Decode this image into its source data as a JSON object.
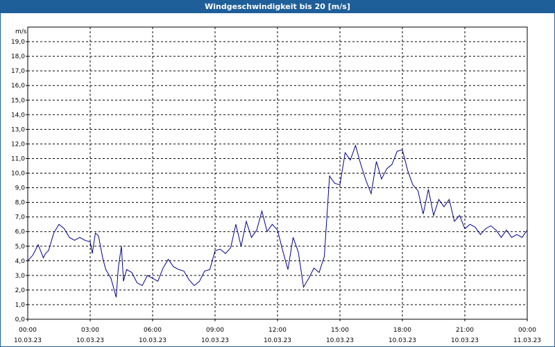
{
  "window": {
    "title": "Windgeschwindigkeit bis 20 [m/s]"
  },
  "chart_data": {
    "type": "line",
    "title": "Windgeschwindigkeit bis 20 [m/s]",
    "ylabel": "m/s",
    "xlabel": "",
    "ylim": [
      0,
      20
    ],
    "xlim_hours": [
      0,
      24
    ],
    "grid": true,
    "y_ticks": [
      "0,0",
      "1,0",
      "2,0",
      "3,0",
      "4,0",
      "5,0",
      "6,0",
      "7,0",
      "8,0",
      "9,0",
      "10,0",
      "11,0",
      "12,0",
      "13,0",
      "14,0",
      "15,0",
      "16,0",
      "17,0",
      "18,0",
      "19,0"
    ],
    "x_ticks": [
      {
        "time": "00:00",
        "date": "10.03.23",
        "hour": 0
      },
      {
        "time": "03:00",
        "date": "10.03.23",
        "hour": 3
      },
      {
        "time": "06:00",
        "date": "10.03.23",
        "hour": 6
      },
      {
        "time": "09:00",
        "date": "10.03.23",
        "hour": 9
      },
      {
        "time": "12:00",
        "date": "10.03.23",
        "hour": 12
      },
      {
        "time": "15:00",
        "date": "10.03.23",
        "hour": 15
      },
      {
        "time": "18:00",
        "date": "10.03.23",
        "hour": 18
      },
      {
        "time": "21:00",
        "date": "10.03.23",
        "hour": 21
      },
      {
        "time": "00:00",
        "date": "11.03.23",
        "hour": 24
      }
    ],
    "series": [
      {
        "color": "#00008b",
        "x": [
          0.0,
          0.25,
          0.5,
          0.75,
          0.85,
          1.0,
          1.25,
          1.5,
          1.75,
          2.0,
          2.25,
          2.5,
          2.75,
          3.0,
          3.1,
          3.25,
          3.4,
          3.6,
          3.75,
          4.0,
          4.25,
          4.35,
          4.5,
          4.6,
          4.75,
          5.0,
          5.25,
          5.5,
          5.75,
          6.0,
          6.25,
          6.5,
          6.75,
          7.0,
          7.25,
          7.5,
          7.75,
          8.0,
          8.25,
          8.5,
          8.75,
          9.0,
          9.25,
          9.5,
          9.75,
          10.0,
          10.25,
          10.5,
          10.75,
          11.0,
          11.25,
          11.5,
          11.75,
          12.0,
          12.25,
          12.5,
          12.75,
          13.0,
          13.25,
          13.5,
          13.75,
          14.0,
          14.25,
          14.5,
          14.75,
          15.0,
          15.25,
          15.5,
          15.75,
          16.0,
          16.25,
          16.5,
          16.75,
          17.0,
          17.25,
          17.5,
          17.75,
          18.0,
          18.25,
          18.5,
          18.75,
          19.0,
          19.25,
          19.5,
          19.75,
          20.0,
          20.25,
          20.5,
          20.75,
          21.0,
          21.25,
          21.5,
          21.75,
          22.0,
          22.25,
          22.5,
          22.75,
          23.0,
          23.25,
          23.5,
          23.75,
          24.0
        ],
        "y": [
          4.0,
          4.4,
          5.1,
          4.2,
          4.5,
          4.7,
          5.9,
          6.5,
          6.2,
          5.6,
          5.4,
          5.6,
          5.4,
          5.3,
          4.5,
          5.9,
          5.7,
          4.2,
          3.4,
          2.8,
          1.5,
          3.5,
          5.0,
          2.6,
          3.4,
          3.2,
          2.5,
          2.3,
          3.0,
          2.8,
          2.6,
          3.5,
          4.1,
          3.6,
          3.4,
          3.3,
          2.7,
          2.3,
          2.6,
          3.3,
          3.4,
          4.7,
          4.8,
          4.5,
          4.9,
          6.5,
          5.0,
          6.7,
          5.6,
          6.1,
          7.4,
          6.0,
          6.5,
          6.1,
          4.7,
          3.4,
          5.6,
          4.6,
          2.2,
          2.8,
          3.5,
          3.2,
          4.3,
          9.8,
          9.3,
          9.2,
          11.4,
          10.9,
          11.9,
          10.6,
          9.5,
          8.6,
          10.8,
          9.6,
          10.3,
          10.6,
          11.5,
          11.6,
          10.2,
          9.2,
          8.8,
          7.2,
          8.9,
          7.1,
          8.2,
          7.7,
          8.2,
          6.7,
          7.1,
          6.2,
          6.5,
          6.3,
          5.8,
          6.2,
          6.4,
          6.1,
          5.6,
          6.1,
          5.6,
          5.8,
          5.6,
          6.1
        ]
      }
    ]
  }
}
